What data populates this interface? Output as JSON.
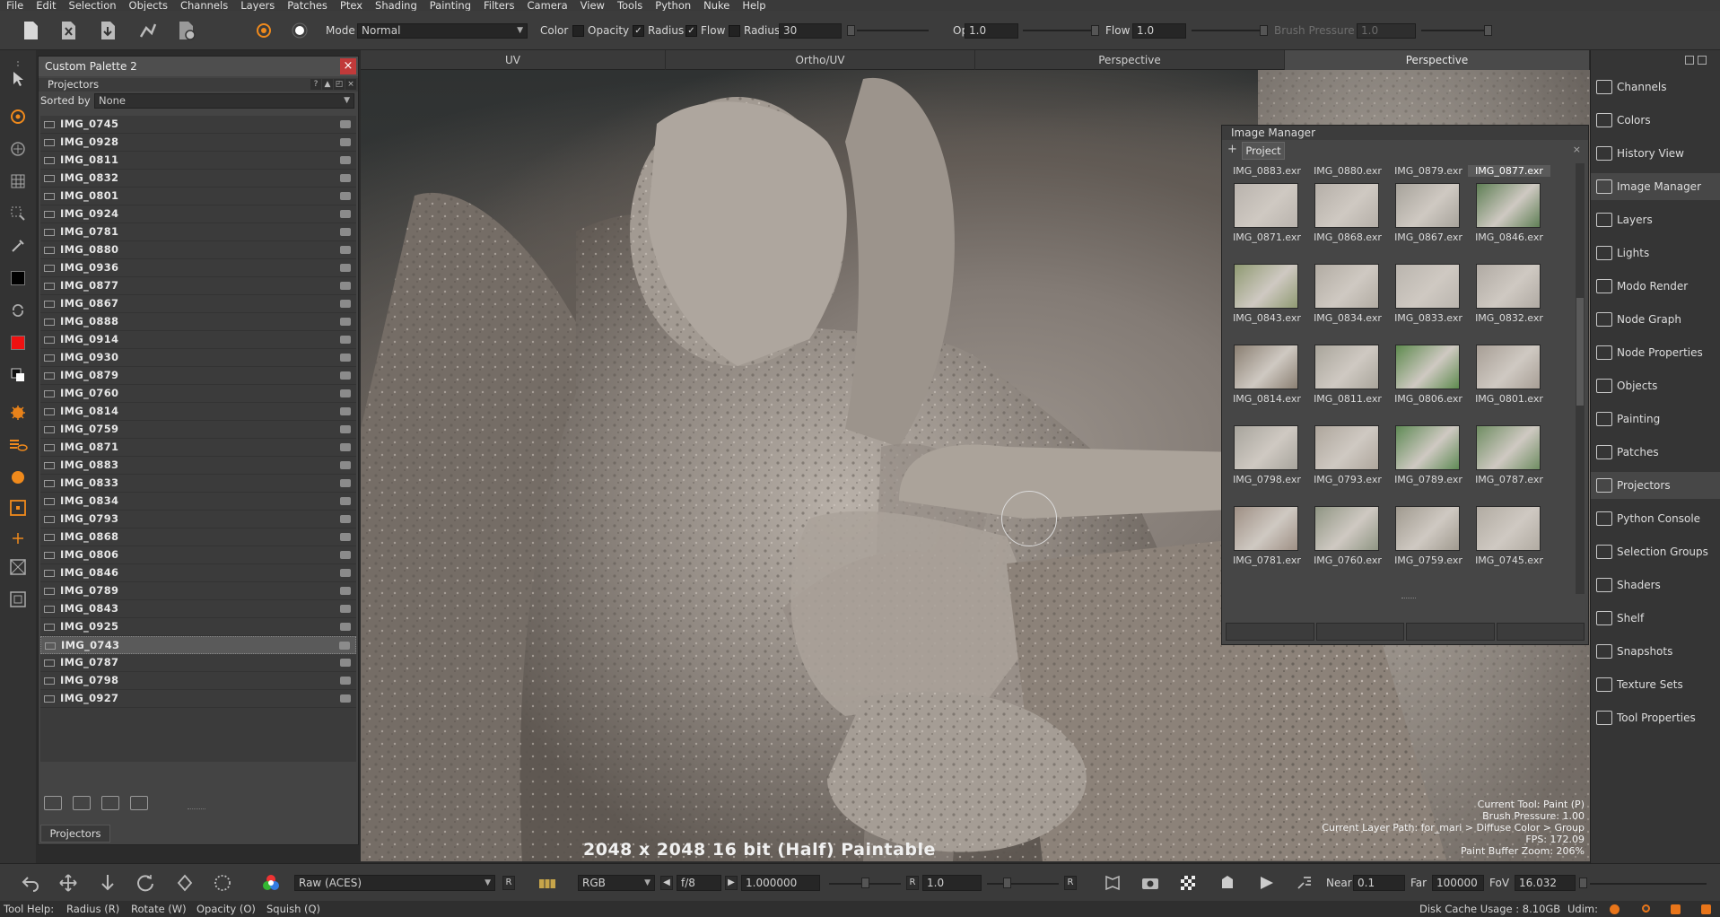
{
  "menu": [
    "File",
    "Edit",
    "Selection",
    "Objects",
    "Channels",
    "Layers",
    "Patches",
    "Ptex",
    "Shading",
    "Painting",
    "Filters",
    "Camera",
    "View",
    "Tools",
    "Python",
    "Nuke",
    "Help"
  ],
  "toolbar": {
    "mode_label": "Mode",
    "mode_value": "Normal",
    "color_label": "Color",
    "opacity_check_label": "Opacity",
    "radius_check_label": "Radius",
    "flow_check_label": "Flow",
    "radius_label": "Radius",
    "radius_value": "30",
    "opacity_label": "Opacity",
    "opacity_value": "1.0",
    "flow_label": "Flow",
    "flow_value": "1.0",
    "brush_pressure_label": "Brush Pressure",
    "brush_pressure_value": "1.0"
  },
  "palette": {
    "title": "Custom Palette 2",
    "subheader": "Projectors",
    "sorted_by_label": "Sorted by",
    "sorted_by_value": "None",
    "projectors": [
      "IMG_0745",
      "IMG_0928",
      "IMG_0811",
      "IMG_0832",
      "IMG_0801",
      "IMG_0924",
      "IMG_0781",
      "IMG_0880",
      "IMG_0936",
      "IMG_0877",
      "IMG_0867",
      "IMG_0888",
      "IMG_0914",
      "IMG_0930",
      "IMG_0879",
      "IMG_0760",
      "IMG_0814",
      "IMG_0759",
      "IMG_0871",
      "IMG_0883",
      "IMG_0833",
      "IMG_0834",
      "IMG_0793",
      "IMG_0868",
      "IMG_0806",
      "IMG_0846",
      "IMG_0789",
      "IMG_0843",
      "IMG_0925",
      "IMG_0743",
      "IMG_0787",
      "IMG_0798",
      "IMG_0927"
    ],
    "selected": "IMG_0743",
    "tab": "Projectors"
  },
  "viewport": {
    "tabs": [
      "UV",
      "Ortho/UV",
      "Perspective",
      "Perspective"
    ],
    "active_tab": 3,
    "resolution_info": "2048 x 2048 16 bit (Half) Paintable",
    "hud": [
      "Current Tool: Paint (P)",
      "Brush Pressure: 1.00",
      "Current Layer Path: for_mari > Diffuse Color > Group",
      "FPS: 172.09",
      "Paint Buffer Zoom: 206%"
    ]
  },
  "image_manager": {
    "title": "Image Manager",
    "tab": "Project",
    "header_names": [
      "IMG_0883.exr",
      "IMG_0880.exr",
      "IMG_0879.exr",
      "IMG_0877.exr"
    ],
    "rows": [
      [
        "IMG_0871.exr",
        "IMG_0868.exr",
        "IMG_0867.exr",
        "IMG_0846.exr"
      ],
      [
        "IMG_0843.exr",
        "IMG_0834.exr",
        "IMG_0833.exr",
        "IMG_0832.exr"
      ],
      [
        "IMG_0814.exr",
        "IMG_0811.exr",
        "IMG_0806.exr",
        "IMG_0801.exr"
      ],
      [
        "IMG_0798.exr",
        "IMG_0793.exr",
        "IMG_0789.exr",
        "IMG_0787.exr"
      ],
      [
        "IMG_0781.exr",
        "IMG_0760.exr",
        "IMG_0759.exr",
        "IMG_0745.exr"
      ]
    ],
    "thumb_colors": [
      [
        "#b9b3ad",
        "#b5afa8",
        "#a7a39b",
        "#5f7f55"
      ],
      [
        "#8f9a72",
        "#b2aca3",
        "#bab5ae",
        "#b0aaa3"
      ],
      [
        "#8a7f72",
        "#a9a59b",
        "#5e8a4e",
        "#a79e95"
      ],
      [
        "#a7a49c",
        "#aea69c",
        "#5f8a55",
        "#6f8d62"
      ],
      [
        "#9e8f84",
        "#8f9583",
        "#a09a8f",
        "#b1aba2"
      ]
    ]
  },
  "right_panel": {
    "items": [
      "Channels",
      "Colors",
      "History View",
      "Image Manager",
      "Layers",
      "Lights",
      "Modo Render",
      "Node Graph",
      "Node Properties",
      "Objects",
      "Painting",
      "Patches",
      "Projectors",
      "Python Console",
      "Selection Groups",
      "Shaders",
      "Shelf",
      "Snapshots",
      "Texture Sets",
      "Tool Properties"
    ],
    "active": [
      "Image Manager",
      "Projectors"
    ]
  },
  "bottom": {
    "colorspace": "Raw (ACES)",
    "r_button": "R",
    "channel": "RGB",
    "fstop": "f/8",
    "exposure": "1.000000",
    "gain_r": "R",
    "gain": "1.0",
    "gamma_r": "R",
    "near_label": "Near",
    "near_value": "0.1",
    "far_label": "Far",
    "far_value": "100000",
    "fov_label": "FoV",
    "fov_value": "16.032"
  },
  "status": {
    "tool_help": "Tool Help:",
    "hints": [
      "Radius (R)",
      "Rotate (W)",
      "Opacity (O)",
      "Squish (Q)"
    ],
    "disk_cache": "Disk Cache Usage : 8.10GB",
    "udim_label": "Udim:"
  }
}
